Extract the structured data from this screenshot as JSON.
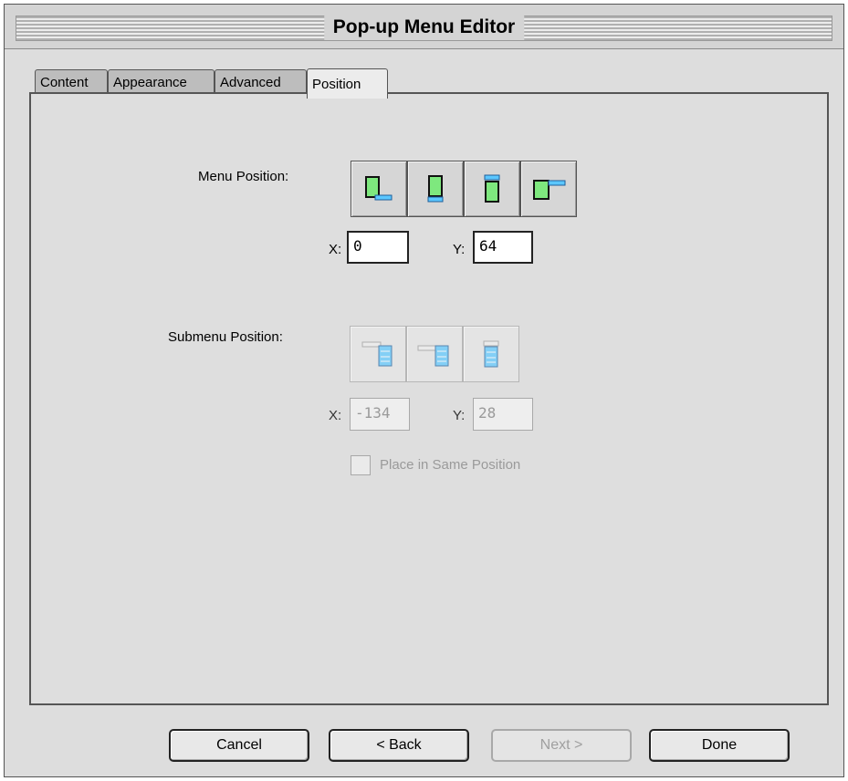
{
  "window": {
    "title": "Pop-up Menu Editor"
  },
  "tabs": [
    {
      "label": "Content",
      "active": false
    },
    {
      "label": "Appearance",
      "active": false
    },
    {
      "label": "Advanced",
      "active": false
    },
    {
      "label": "Position",
      "active": true
    }
  ],
  "menu_position": {
    "label": "Menu Position:",
    "buttons": [
      "menu-below-left-icon",
      "menu-below-center-icon",
      "menu-above-icon",
      "menu-right-icon"
    ],
    "x_label": "X:",
    "x_value": "0",
    "y_label": "Y:",
    "y_value": "64"
  },
  "submenu_position": {
    "label": "Submenu Position:",
    "enabled": false,
    "buttons": [
      "submenu-right-low-icon",
      "submenu-right-top-icon",
      "submenu-overlap-icon"
    ],
    "x_label": "X:",
    "x_value": "-134",
    "y_label": "Y:",
    "y_value": "28",
    "same_position_label": "Place in Same Position",
    "same_position_checked": false
  },
  "footer": {
    "cancel_label": "Cancel",
    "back_label": "< Back",
    "next_label": "Next >",
    "next_enabled": false,
    "done_label": "Done"
  },
  "colors": {
    "menu_fill": "#7ee87e",
    "submenu_fill": "#5bc7ff"
  }
}
